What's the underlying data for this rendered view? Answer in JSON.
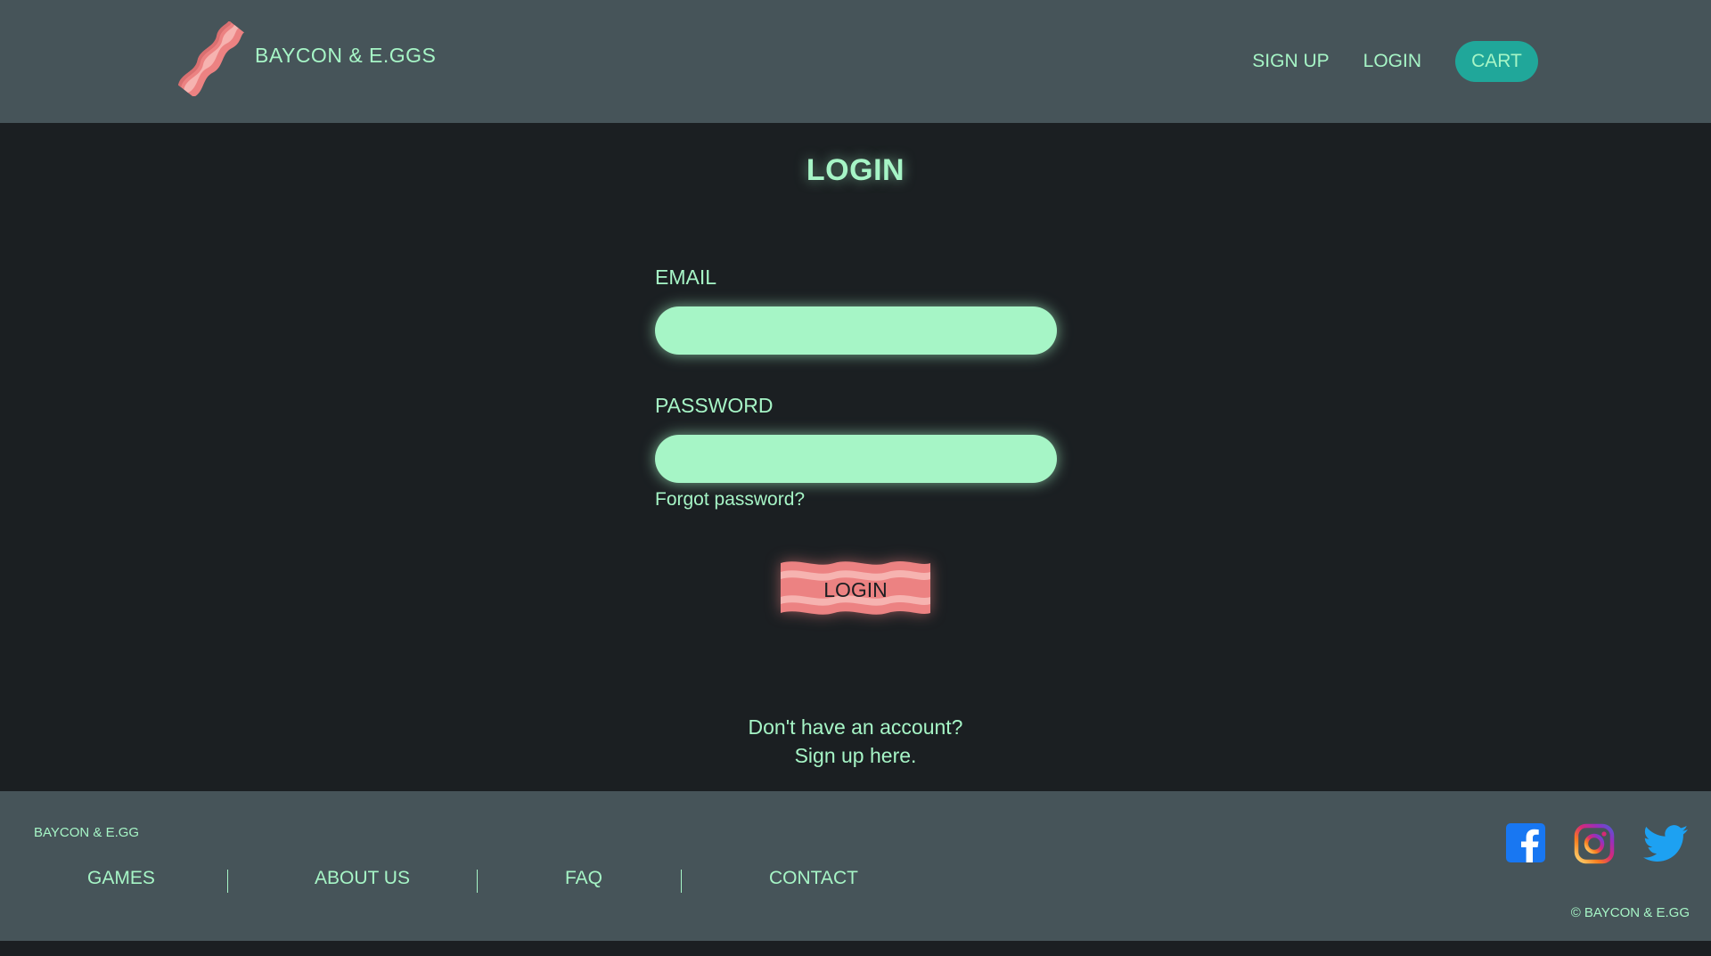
{
  "header": {
    "brand_name": "BAYCON & E.GGS",
    "nav": {
      "signup_label": "SIGN UP",
      "login_label": "LOGIN",
      "cart_label": "CART"
    }
  },
  "main": {
    "title": "LOGIN",
    "email_label": "EMAIL",
    "email_value": "",
    "password_label": "PASSWORD",
    "password_value": "",
    "forgot_label": "Forgot password?",
    "login_button_label": "LOGIN",
    "signup_prompt_line1": "Don't have an account?",
    "signup_prompt_prefix": "Sign up ",
    "signup_prompt_link": "here",
    "signup_prompt_suffix": "."
  },
  "footer": {
    "brand": "BAYCON & E.GG",
    "links": [
      "GAMES",
      "ABOUT US",
      "FAQ",
      "CONTACT"
    ],
    "social": [
      "facebook-icon",
      "instagram-icon",
      "twitter-icon"
    ],
    "copyright": "© BAYCON & E.GG"
  },
  "colors": {
    "mint": "#a6f5c6",
    "header_bg": "#465459",
    "page_bg": "#1b1f22",
    "cart_bg": "#20a79a",
    "bacon": "#ec8282"
  }
}
